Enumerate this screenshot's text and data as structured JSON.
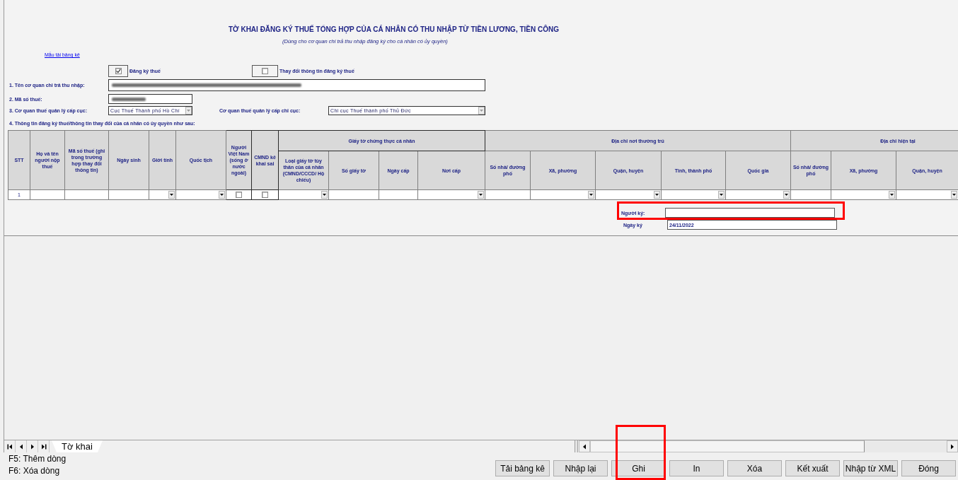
{
  "form": {
    "title": "TỜ KHAI ĐĂNG KÝ THUẾ TỔNG HỢP CỦA CÁ NHÂN CÓ THU NHẬP TỪ TIỀN LƯƠNG, TIỀN CÔNG",
    "subtitle": "(Dùng cho cơ quan chi trả thu nhập đăng ký cho cá nhân có ủy quyền)",
    "template_link": "Mẫu tải bảng kê",
    "options": [
      {
        "label": "Đăng ký thuế",
        "checked": true
      },
      {
        "label": "Thay đổi thông tin đăng ký thuế",
        "checked": false
      }
    ],
    "payer_name": {
      "label": "1. Tên cơ quan chi trả thu nhập:",
      "redacted": true
    },
    "tax_code": {
      "label": "2. Mã số thuế:",
      "redacted": true
    },
    "tax_department": {
      "label": "3. Cơ quan thuế quản lý cấp cục:",
      "value": "Cục Thuế Thành phố Hồ Chí"
    },
    "tax_branch": {
      "label": "Cơ quan thuế quản lý cấp chi cục:",
      "value": "Chi cục Thuế thành phố Thủ Đức"
    },
    "section_4": "4. Thông tin đăng ký thuế/thông tin thay đổi của cá nhân có ủy quyền như sau:"
  },
  "table": {
    "headers": [
      {
        "kind": "single",
        "label": "STT"
      },
      {
        "kind": "single",
        "label": "Họ và tên người nộp thuế"
      },
      {
        "kind": "single",
        "label": "Mã số thuế (ghi trong trường hợp thay đổi thông tin)"
      },
      {
        "kind": "single",
        "label": "Ngày sinh"
      },
      {
        "kind": "single",
        "label": "Giới tính"
      },
      {
        "kind": "single",
        "label": "Quốc tịch"
      },
      {
        "kind": "single",
        "label": "Người Việt Nam (sống ở nước ngoài)"
      },
      {
        "kind": "single",
        "label": "CMND kê khai sai"
      },
      {
        "kind": "group",
        "label": "Giấy tờ chứng thực cá nhân",
        "columns": [
          {
            "label": "Loại giấy tờ tùy thân của cá nhân (CMND/CCCD/ Hộ chiếu)"
          },
          {
            "label": "Số giấy tờ"
          },
          {
            "label": "Ngày cấp"
          },
          {
            "label": "Nơi cấp"
          }
        ]
      },
      {
        "kind": "group",
        "label": "Địa chỉ nơi thường trú",
        "columns": [
          {
            "label": "Số nhà/ đường phố"
          },
          {
            "label": "Xã, phường"
          },
          {
            "label": "Quận, huyện"
          },
          {
            "label": "Tỉnh, thành phố"
          },
          {
            "label": "Quốc gia"
          }
        ]
      },
      {
        "kind": "group",
        "label": "Địa chỉ hiện tại",
        "columns": [
          {
            "label": "Số nhà/ đường phố"
          },
          {
            "label": "Xã, phường"
          },
          {
            "label": "Quận, huyện"
          }
        ]
      }
    ],
    "rows": [
      {
        "cells": [
          {
            "kind": "text",
            "value": "1"
          },
          {
            "kind": "text"
          },
          {
            "kind": "text"
          },
          {
            "kind": "text"
          },
          {
            "kind": "select"
          },
          {
            "kind": "select"
          },
          {
            "kind": "check",
            "checked": false
          },
          {
            "kind": "check",
            "checked": false
          },
          {
            "kind": "select"
          },
          {
            "kind": "text"
          },
          {
            "kind": "text"
          },
          {
            "kind": "select"
          },
          {
            "kind": "text"
          },
          {
            "kind": "select"
          },
          {
            "kind": "select"
          },
          {
            "kind": "select"
          },
          {
            "kind": "select"
          },
          {
            "kind": "text"
          },
          {
            "kind": "select"
          },
          {
            "kind": "select"
          }
        ]
      }
    ]
  },
  "signature": {
    "signer": {
      "label": "Người ký:",
      "highlighted": true
    },
    "date": {
      "label": "Ngày ký",
      "value": "24/11/2022"
    }
  },
  "sheet_tabs": [
    {
      "label": "Tờ khai",
      "selected": true
    }
  ],
  "shortcuts": [
    "F5: Thêm dòng",
    "F6: Xóa dòng"
  ],
  "buttons": [
    {
      "label": "Tải bảng kê",
      "highlighted": false
    },
    {
      "label": "Nhập lại",
      "highlighted": false
    },
    {
      "label": "Ghi",
      "highlighted": true
    },
    {
      "label": "In",
      "highlighted": false
    },
    {
      "label": "Xóa",
      "highlighted": false
    },
    {
      "label": "Kết xuất",
      "highlighted": false
    },
    {
      "label": "Nhập từ XML",
      "highlighted": false
    },
    {
      "label": "Đóng",
      "highlighted": false
    }
  ]
}
